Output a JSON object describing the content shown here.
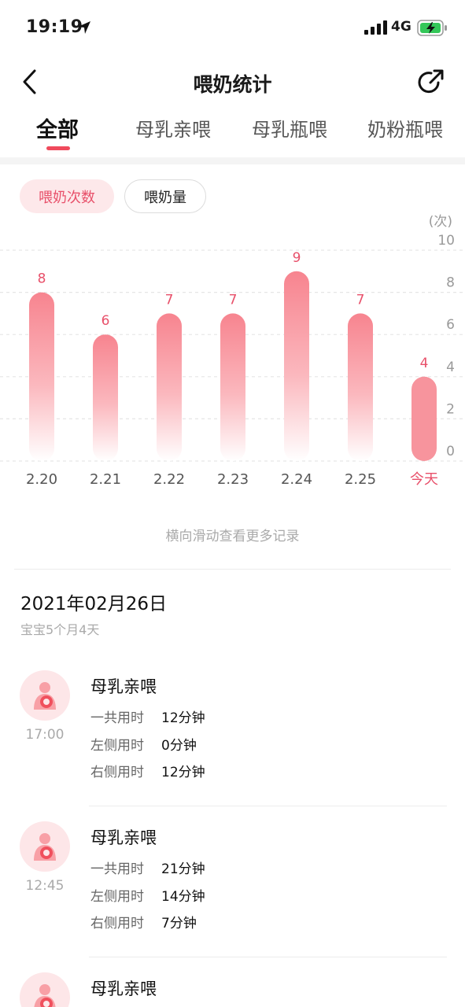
{
  "status_bar": {
    "time": "19:19",
    "network": "4G",
    "icons": [
      "location-arrow-icon",
      "signal-bars-icon",
      "battery-charging-icon"
    ]
  },
  "nav": {
    "title": "喂奶统计",
    "icons": [
      "back-chevron-icon",
      "share-icon"
    ]
  },
  "tabs": [
    {
      "label": "全部",
      "active": true
    },
    {
      "label": "母乳亲喂",
      "active": false
    },
    {
      "label": "母乳瓶喂",
      "active": false
    },
    {
      "label": "奶粉瓶喂",
      "active": false
    }
  ],
  "toggle": {
    "count_label": "喂奶次数",
    "amount_label": "喂奶量",
    "selected": "count"
  },
  "chart_data": {
    "type": "bar",
    "unit_label": "(次)",
    "categories": [
      "2.20",
      "2.21",
      "2.22",
      "2.23",
      "2.24",
      "2.25",
      "今天"
    ],
    "values": [
      8,
      6,
      7,
      7,
      9,
      7,
      4
    ],
    "y_ticks": [
      10,
      8,
      6,
      4,
      2,
      0
    ],
    "ylim": [
      0,
      10
    ],
    "grid": true,
    "gridline_style": "dashed",
    "highlight_category": "今天",
    "colors": {
      "bar_top": "#f7848f",
      "bar_fade": "#ffffff",
      "bar_today": "#f7949d",
      "value_label": "#e8506a",
      "axis_text": "#999999",
      "today_text": "#e8506a",
      "grid": "#e6e6e6"
    }
  },
  "hint": "横向滑动查看更多记录",
  "day": {
    "date": "2021年02月26日",
    "age": "宝宝5个月4天"
  },
  "records": [
    {
      "time": "17:00",
      "type": "母乳亲喂",
      "icon": "breastfeeding-icon",
      "rows": [
        {
          "label": "一共用时",
          "value": "12分钟"
        },
        {
          "label": "左侧用时",
          "value": "0分钟"
        },
        {
          "label": "右侧用时",
          "value": "12分钟"
        }
      ]
    },
    {
      "time": "12:45",
      "type": "母乳亲喂",
      "icon": "breastfeeding-icon",
      "rows": [
        {
          "label": "一共用时",
          "value": "21分钟"
        },
        {
          "label": "左侧用时",
          "value": "14分钟"
        },
        {
          "label": "右侧用时",
          "value": "7分钟"
        }
      ]
    },
    {
      "time": "",
      "type": "母乳亲喂",
      "icon": "breastfeeding-icon",
      "rows": []
    }
  ],
  "colors": {
    "accent": "#f04a5c",
    "accent_soft": "#fde8ea"
  }
}
